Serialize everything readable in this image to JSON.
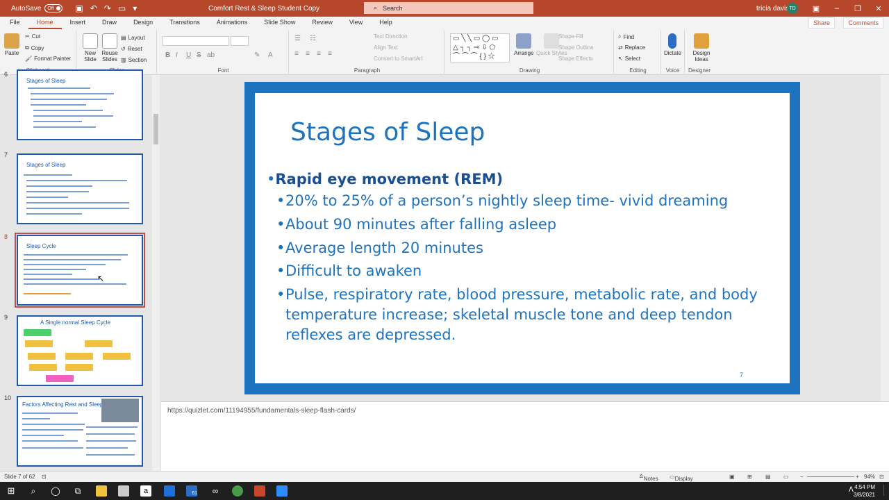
{
  "titlebar": {
    "autosave_label": "AutoSave",
    "autosave_state": "Off",
    "doc_title": "Comfort Rest & Sleep Student Copy",
    "search_placeholder": "Search",
    "user_name": "tricia davis",
    "user_initials": "TD"
  },
  "menu": {
    "items": [
      "File",
      "Home",
      "Insert",
      "Draw",
      "Design",
      "Transitions",
      "Animations",
      "Slide Show",
      "Review",
      "View",
      "Help"
    ],
    "active": "Home",
    "share_label": "Share",
    "comments_label": "Comments"
  },
  "ribbon": {
    "clipboard": {
      "label": "Clipboard",
      "paste": "Paste",
      "cut": "Cut",
      "copy": "Copy",
      "format_painter": "Format Painter"
    },
    "slides": {
      "label": "Slides",
      "new_slide": "New Slide",
      "reuse_slides": "Reuse Slides",
      "layout": "Layout",
      "reset": "Reset",
      "section": "Section"
    },
    "font": {
      "label": "Font",
      "bold": "B",
      "italic": "I",
      "underline": "U",
      "strike": "S",
      "shadow": "ab"
    },
    "paragraph": {
      "label": "Paragraph",
      "text_direction": "Text Direction",
      "align_text": "Align Text",
      "smartart": "Convert to SmartArt"
    },
    "drawing": {
      "label": "Drawing",
      "arrange": "Arrange",
      "quick_styles": "Quick Styles",
      "shape_fill": "Shape Fill",
      "shape_outline": "Shape Outline",
      "shape_effects": "Shape Effects"
    },
    "editing": {
      "label": "Editing",
      "find": "Find",
      "replace": "Replace",
      "select": "Select"
    },
    "voice": {
      "label": "Voice",
      "dictate": "Dictate"
    },
    "designer": {
      "label": "Designer",
      "design_ideas": "Design Ideas"
    }
  },
  "thumbnails": [
    {
      "num": "6",
      "title": "Stages of Sleep"
    },
    {
      "num": "7",
      "title": "Stages of Sleep"
    },
    {
      "num": "8",
      "title": "Sleep Cycle"
    },
    {
      "num": "9",
      "title": "A Single normal Sleep Cycle"
    },
    {
      "num": "10",
      "title": "Factors Affecting Rest and Sleep"
    }
  ],
  "slide": {
    "title": "Stages of Sleep",
    "main_bullet": "Rapid eye movement (REM)",
    "sub_bullets": [
      "20% to 25% of a person’s nightly sleep time- vivid dreaming",
      "About 90 minutes after falling asleep",
      "Average length 20 minutes",
      "Difficult to awaken",
      "Pulse, respiratory rate, blood pressure, metabolic rate, and body temperature increase; skeletal muscle tone and deep tendon reflexes are depressed."
    ],
    "number": "7"
  },
  "notes": {
    "text": "https://quizlet.com/11194955/fundamentals-sleep-flash-cards/"
  },
  "statusbar": {
    "slide_info": "Slide 7 of 62",
    "notes": "Notes",
    "display_settings": "Display Settings",
    "zoom": "94%"
  },
  "taskbar": {
    "time": "4:54 PM",
    "date": "3/8/2021",
    "badge": "61"
  },
  "colors": {
    "accent": "#b7472a",
    "slide_blue": "#1e73be",
    "slide_dark_blue": "#1a4f91"
  }
}
